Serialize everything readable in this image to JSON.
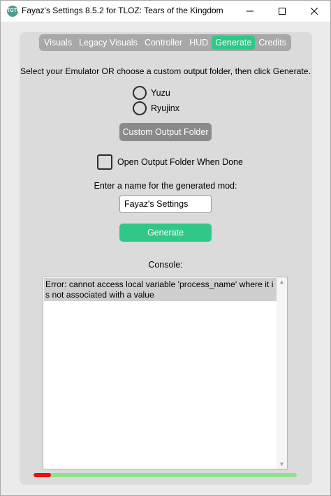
{
  "window": {
    "title": "Fayaz's Settings 8.5.2 for TLOZ: Tears of the Kingdom",
    "icon": "app-logo-icon",
    "icon_text": "TOTK",
    "controls": {
      "minimize": "—",
      "maximize": "☐",
      "close": "✕"
    }
  },
  "tabs": [
    {
      "label": "Visuals",
      "active": false
    },
    {
      "label": "Legacy Visuals",
      "active": false
    },
    {
      "label": "Controller",
      "active": false
    },
    {
      "label": "HUD",
      "active": false
    },
    {
      "label": "Generate",
      "active": true
    },
    {
      "label": "Credits",
      "active": false
    }
  ],
  "generate": {
    "instruction": "Select your Emulator OR choose a custom output folder, then click Generate.",
    "emulators": [
      {
        "label": "Yuzu",
        "selected": false
      },
      {
        "label": "Ryujinx",
        "selected": false
      }
    ],
    "custom_folder_button": "Custom Output Folder",
    "open_folder_checkbox": {
      "label": "Open Output Folder When Done",
      "checked": false
    },
    "name_label": "Enter a name for the generated mod:",
    "name_value": "Fayaz's Settings",
    "generate_button": "Generate",
    "console_label": "Console:",
    "console_text": "Error: cannot access local variable 'process_name' where it is not associated with a value",
    "progress": 0.065
  },
  "colors": {
    "accent": "#2fc886",
    "tab_bar": "#a8a8a8",
    "panel": "#dbdbdb",
    "button_grey": "#8a8a8a",
    "progress_fill": "#e81010",
    "progress_track": "#90e28e"
  }
}
